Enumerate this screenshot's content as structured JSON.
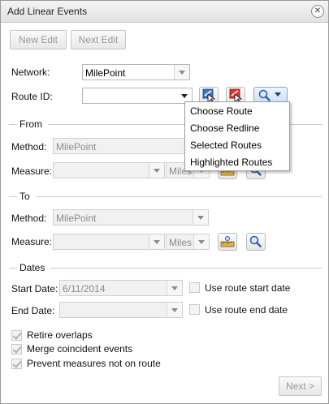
{
  "window": {
    "title": "Add Linear Events",
    "close_icon": "close-icon"
  },
  "toolbar": {
    "new_edit_label": "New Edit",
    "next_edit_label": "Next Edit"
  },
  "network": {
    "label": "Network:",
    "value": "MilePoint"
  },
  "route": {
    "label": "Route ID:",
    "value": "",
    "pick_icon": "route-pick-icon",
    "redline_icon": "redline-pick-icon",
    "search_icon": "magnifier-icon",
    "menu": [
      "Choose Route",
      "Choose Redline",
      "Selected Routes",
      "Highlighted Routes"
    ]
  },
  "from": {
    "title": "From",
    "method_label": "Method:",
    "method_value": "MilePoint",
    "measure_label": "Measure:",
    "measure_value": "",
    "units": "Miles",
    "ruler_icon": "ruler-icon",
    "search_icon": "magnifier-icon"
  },
  "to": {
    "title": "To",
    "method_label": "Method:",
    "method_value": "MilePoint",
    "measure_label": "Measure:",
    "measure_value": "",
    "units": "Miles",
    "ruler_icon": "ruler-icon",
    "search_icon": "magnifier-icon"
  },
  "dates": {
    "title": "Dates",
    "start_label": "Start Date:",
    "start_value": "6/11/2014",
    "use_start_label": "Use route start date",
    "use_start_checked": false,
    "end_label": "End Date:",
    "end_value": "",
    "use_end_label": "Use route end date",
    "use_end_checked": false
  },
  "options": [
    {
      "label": "Retire overlaps",
      "checked": true
    },
    {
      "label": "Merge coincident events",
      "checked": true
    },
    {
      "label": "Prevent measures not on route",
      "checked": true
    }
  ],
  "footer": {
    "next_label": "Next >"
  }
}
